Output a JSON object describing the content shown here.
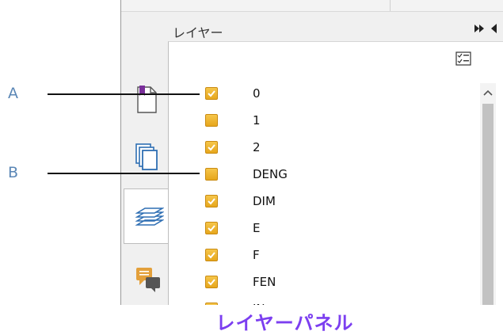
{
  "panel": {
    "title": "レイヤー"
  },
  "layers": [
    {
      "name": "0",
      "checked": true
    },
    {
      "name": "1",
      "checked": false
    },
    {
      "name": "2",
      "checked": true
    },
    {
      "name": "DENG",
      "checked": false
    },
    {
      "name": "DIM",
      "checked": true
    },
    {
      "name": "E",
      "checked": true
    },
    {
      "name": "F",
      "checked": true
    },
    {
      "name": "FEN",
      "checked": true
    },
    {
      "name": "IN",
      "checked": true
    }
  ],
  "callouts": {
    "a": "A",
    "b": "B"
  },
  "caption": "レイヤーパネル",
  "colors": {
    "checkbox": "#f0b43a",
    "caption": "#7c3ff0",
    "callout_letter": "#5b87b6",
    "layers_icon": "#2f6fb3",
    "bookmark": "#7a2f9a",
    "comment_icon": "#e3a03b"
  },
  "icons": {
    "tabs": [
      "bookmark-page-icon",
      "pages-icon",
      "layers-icon",
      "comments-icon"
    ],
    "options": "layer-options-icon",
    "scroll_up": "chevron-up-icon"
  }
}
